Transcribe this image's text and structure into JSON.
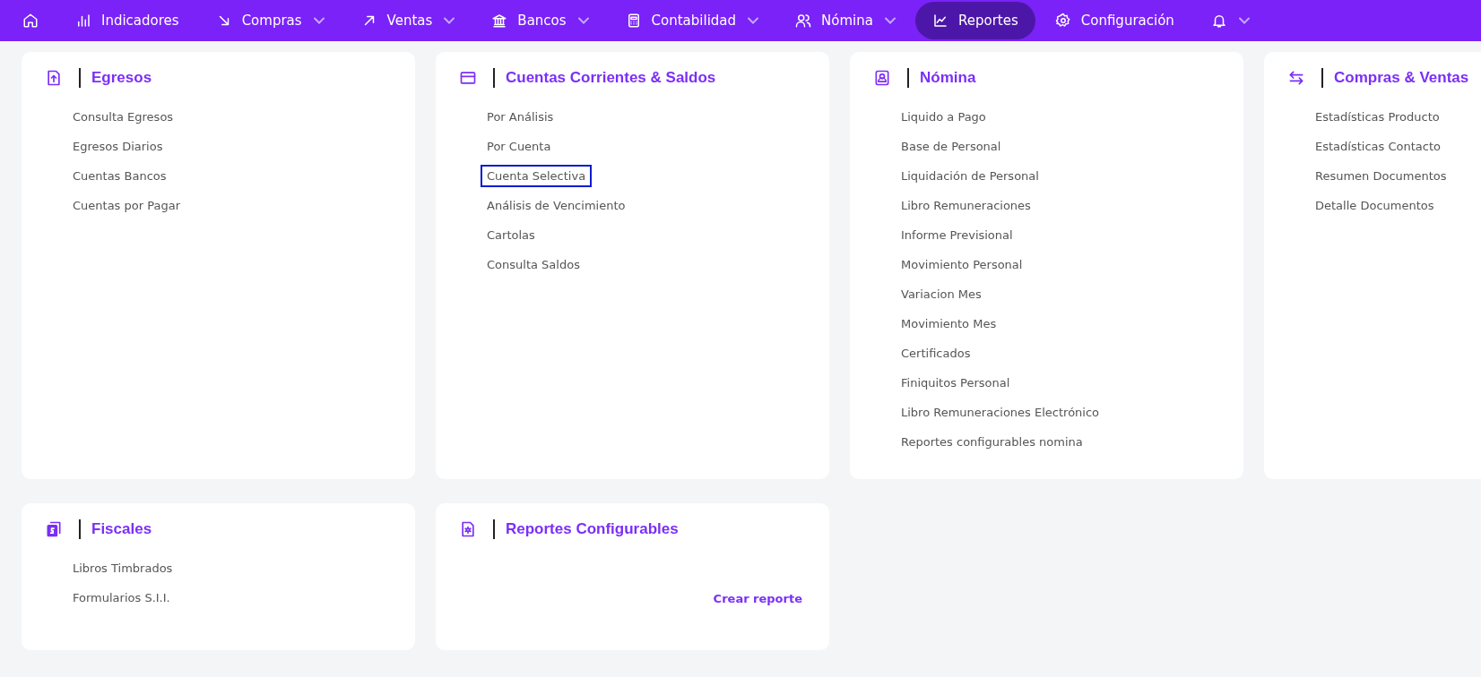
{
  "nav": {
    "items": [
      {
        "dropdown": false,
        "selected": false
      },
      {
        "label": "Indicadores",
        "dropdown": false,
        "selected": false
      },
      {
        "label": "Compras",
        "dropdown": true,
        "selected": false
      },
      {
        "label": "Ventas",
        "dropdown": true,
        "selected": false
      },
      {
        "label": "Bancos",
        "dropdown": true,
        "selected": false
      },
      {
        "label": "Contabilidad",
        "dropdown": true,
        "selected": false
      },
      {
        "label": "Nómina",
        "dropdown": true,
        "selected": false
      },
      {
        "label": "Reportes",
        "dropdown": false,
        "selected": true
      },
      {
        "label": "Configuración",
        "dropdown": false,
        "selected": false
      },
      {
        "dropdown": true,
        "selected": false
      }
    ]
  },
  "rows": [
    {
      "cards": [
        {
          "title": "Egresos",
          "items": [
            {
              "label": "Consulta Egresos",
              "focused": false
            },
            {
              "label": "Egresos Diarios",
              "focused": false
            },
            {
              "label": "Cuentas Bancos",
              "focused": false
            },
            {
              "label": "Cuentas por Pagar",
              "focused": false
            }
          ]
        },
        {
          "title": "Cuentas Corrientes & Saldos",
          "items": [
            {
              "label": "Por Análisis",
              "focused": false
            },
            {
              "label": "Por Cuenta",
              "focused": false
            },
            {
              "label": "Cuenta Selectiva",
              "focused": true
            },
            {
              "label": "Análisis de Vencimiento",
              "focused": false
            },
            {
              "label": "Cartolas",
              "focused": false
            },
            {
              "label": "Consulta Saldos",
              "focused": false
            }
          ]
        },
        {
          "title": "Nómina",
          "items": [
            {
              "label": "Liquido a Pago",
              "focused": false
            },
            {
              "label": "Base de Personal",
              "focused": false
            },
            {
              "label": "Liquidación de Personal",
              "focused": false
            },
            {
              "label": "Libro Remuneraciones",
              "focused": false
            },
            {
              "label": "Informe Previsional",
              "focused": false
            },
            {
              "label": "Movimiento Personal",
              "focused": false
            },
            {
              "label": "Variacion Mes",
              "focused": false
            },
            {
              "label": "Movimiento Mes",
              "focused": false
            },
            {
              "label": "Certificados",
              "focused": false
            },
            {
              "label": "Finiquitos Personal",
              "focused": false
            },
            {
              "label": "Libro Remuneraciones Electrónico",
              "focused": false
            },
            {
              "label": "Reportes configurables nomina",
              "focused": false
            }
          ]
        },
        {
          "title": "Compras & Ventas",
          "items": [
            {
              "label": "Estadísticas Producto",
              "focused": false
            },
            {
              "label": "Estadísticas Contacto",
              "focused": false
            },
            {
              "label": "Resumen Documentos",
              "focused": false
            },
            {
              "label": "Detalle Documentos",
              "focused": false
            }
          ]
        }
      ]
    },
    {
      "cards": [
        {
          "title": "Fiscales",
          "items": [
            {
              "label": "Libros Timbrados",
              "focused": false
            },
            {
              "label": "Formularios S.I.I.",
              "focused": false
            }
          ]
        },
        {
          "title": "Reportes Configurables",
          "action": "Crear reporte"
        }
      ]
    }
  ]
}
